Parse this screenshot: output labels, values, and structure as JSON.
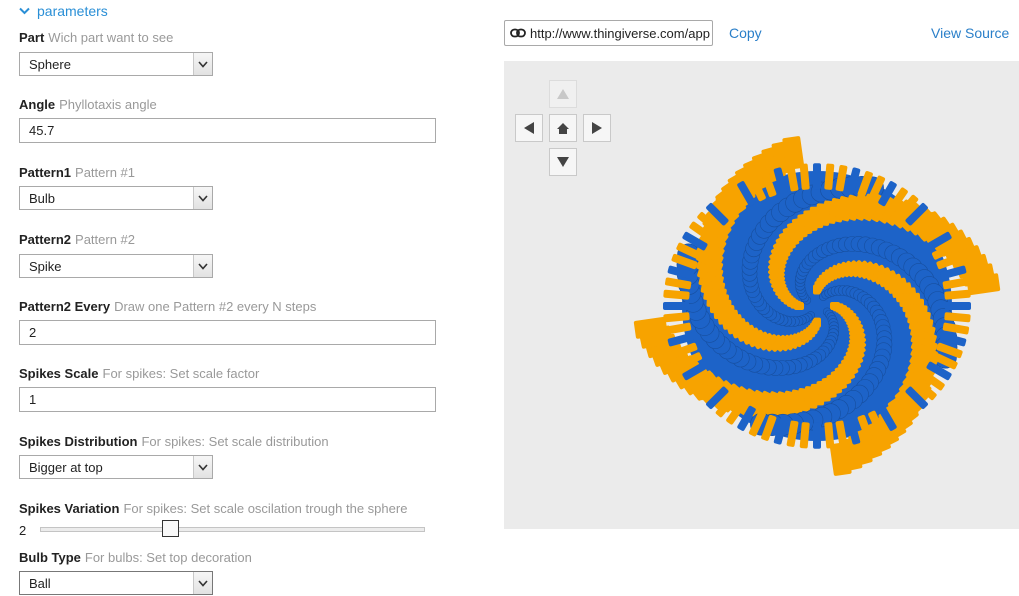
{
  "section": {
    "title": "parameters"
  },
  "params": [
    {
      "name": "Part",
      "desc": "Wich part want to see",
      "type": "select",
      "value": "Sphere"
    },
    {
      "name": "Angle",
      "desc": "Phyllotaxis angle",
      "type": "text",
      "value": "45.7"
    },
    {
      "name": "Pattern1",
      "desc": "Pattern #1",
      "type": "select",
      "value": "Bulb"
    },
    {
      "name": "Pattern2",
      "desc": "Pattern #2",
      "type": "select",
      "value": "Spike"
    },
    {
      "name": "Pattern2 Every",
      "desc": "Draw one Pattern #2 every N steps",
      "type": "text",
      "value": "2"
    },
    {
      "name": "Spikes Scale",
      "desc": "For spikes: Set scale factor",
      "type": "text",
      "value": "1"
    },
    {
      "name": "Spikes Distribution",
      "desc": "For spikes: Set scale distribution",
      "type": "select",
      "value": "Bigger at top"
    },
    {
      "name": "Spikes Variation",
      "desc": "For spikes: Set scale oscilation trough the sphere",
      "type": "slider",
      "value": "2",
      "level": 0.34
    },
    {
      "name": "Bulb Type",
      "desc": "For bulbs: Set top decoration",
      "type": "select",
      "value": "Ball"
    }
  ],
  "toolbar": {
    "url": "http://www.thingiverse.com/app",
    "copy_label": "Copy",
    "view_source_label": "View Source"
  },
  "viewer": {
    "nav_icons": [
      "arrow-up-icon",
      "arrow-left-icon",
      "home-icon",
      "arrow-right-icon",
      "arrow-down-icon"
    ],
    "colors": {
      "background": "#ebebeb",
      "blue": "#1d63c8",
      "orange": "#f7a300"
    }
  }
}
